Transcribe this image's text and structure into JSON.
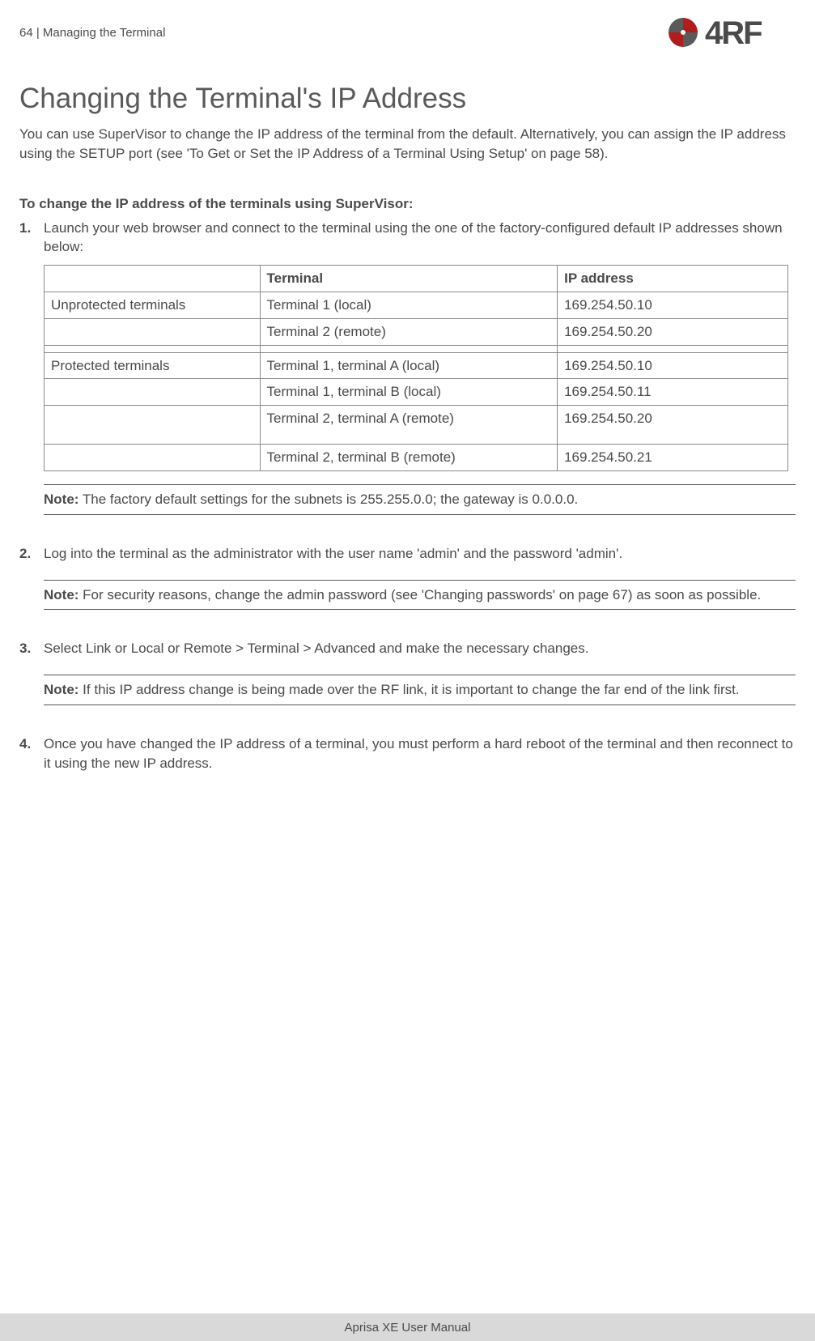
{
  "header": {
    "page_number": "64",
    "separator": "  |  ",
    "chapter": "Managing the Terminal",
    "brand": "4RF"
  },
  "title": "Changing the Terminal's IP Address",
  "intro": "You can use SuperVisor to change the IP address of the terminal from the default.  Alternatively, you can assign the IP address using the SETUP port (see 'To Get or Set the IP Address of a Terminal Using Setup' on page 58).",
  "procedure_heading": "To change the IP address of the terminals using SuperVisor:",
  "steps": {
    "s1": {
      "num": "1.",
      "text": "Launch your web browser and connect to the terminal using the one of the factory-configured default IP addresses shown below:"
    },
    "s2": {
      "num": "2.",
      "text": "Log into the terminal as the administrator with the user name 'admin' and the password 'admin'."
    },
    "s3": {
      "num": "3.",
      "text": "Select Link or Local or Remote > Terminal > Advanced and make the necessary changes."
    },
    "s4": {
      "num": "4.",
      "text": "Once you have changed the IP address of a terminal, you must perform a hard reboot of the terminal and then reconnect to it using the new IP address."
    }
  },
  "table": {
    "headers": {
      "col1": "",
      "col2": "Terminal",
      "col3": "IP address"
    },
    "rows": [
      {
        "col1": "Unprotected terminals",
        "col2": "Terminal 1 (local)",
        "col3": "169.254.50.10"
      },
      {
        "col1": "",
        "col2": "Terminal 2 (remote)",
        "col3": "169.254.50.20"
      },
      {
        "col1": "",
        "col2": "",
        "col3": ""
      },
      {
        "col1": "Protected terminals",
        "col2": "Terminal 1, terminal A (local)",
        "col3": "169.254.50.10"
      },
      {
        "col1": "",
        "col2": "Terminal 1, terminal B (local)",
        "col3": "169.254.50.11"
      },
      {
        "col1": "",
        "col2": "Terminal 2, terminal A (remote)",
        "col3": "169.254.50.20"
      },
      {
        "col1": "",
        "col2": "Terminal 2, terminal B (remote)",
        "col3": "169.254.50.21"
      }
    ]
  },
  "notes": {
    "label": "Note:",
    "n1": " The factory default settings for the subnets is 255.255.0.0; the gateway is 0.0.0.0.",
    "n2": " For security reasons, change the admin password (see 'Changing passwords' on page 67) as soon as possible.",
    "n3": " If this IP address change is being made over the RF link, it is important to change the far end of the link first."
  },
  "footer": "Aprisa XE User Manual"
}
